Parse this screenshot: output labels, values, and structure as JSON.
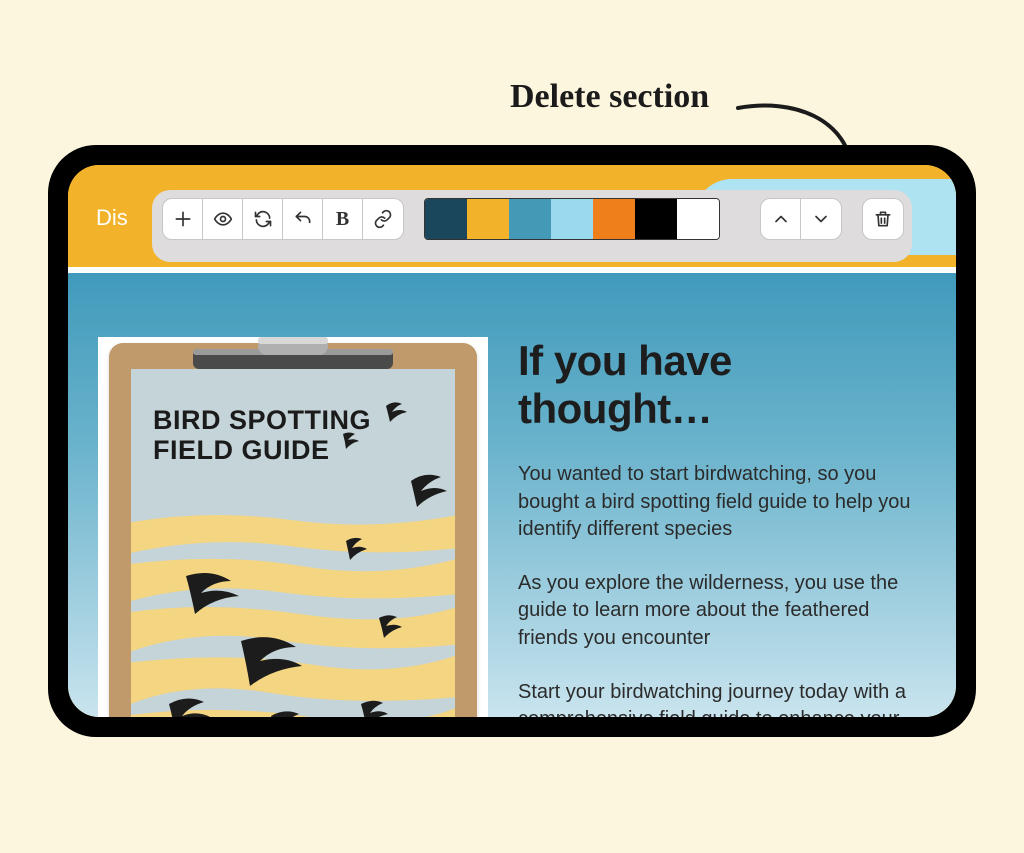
{
  "annotation": {
    "label": "Delete section"
  },
  "header": {
    "tab_peek": "Dis"
  },
  "toolbar": {
    "palette": [
      "#1b475c",
      "#f2b229",
      "#4499b7",
      "#9bd9ee",
      "#ef7f1a",
      "#000000",
      "#ffffff"
    ]
  },
  "clipboard": {
    "title_line1": "BIRD SPOTTING",
    "title_line2": "FIELD GUIDE"
  },
  "content": {
    "heading": "If you have thought…",
    "p1": "You wanted to start birdwatching, so you bought a bird spotting field guide to help you identify different species",
    "p2": "As you explore the wilderness, you use the guide to learn more about the feathered friends you encounter",
    "p3": "Start your birdwatching journey today with a comprehensive field guide to enhance your outdoor experience."
  }
}
